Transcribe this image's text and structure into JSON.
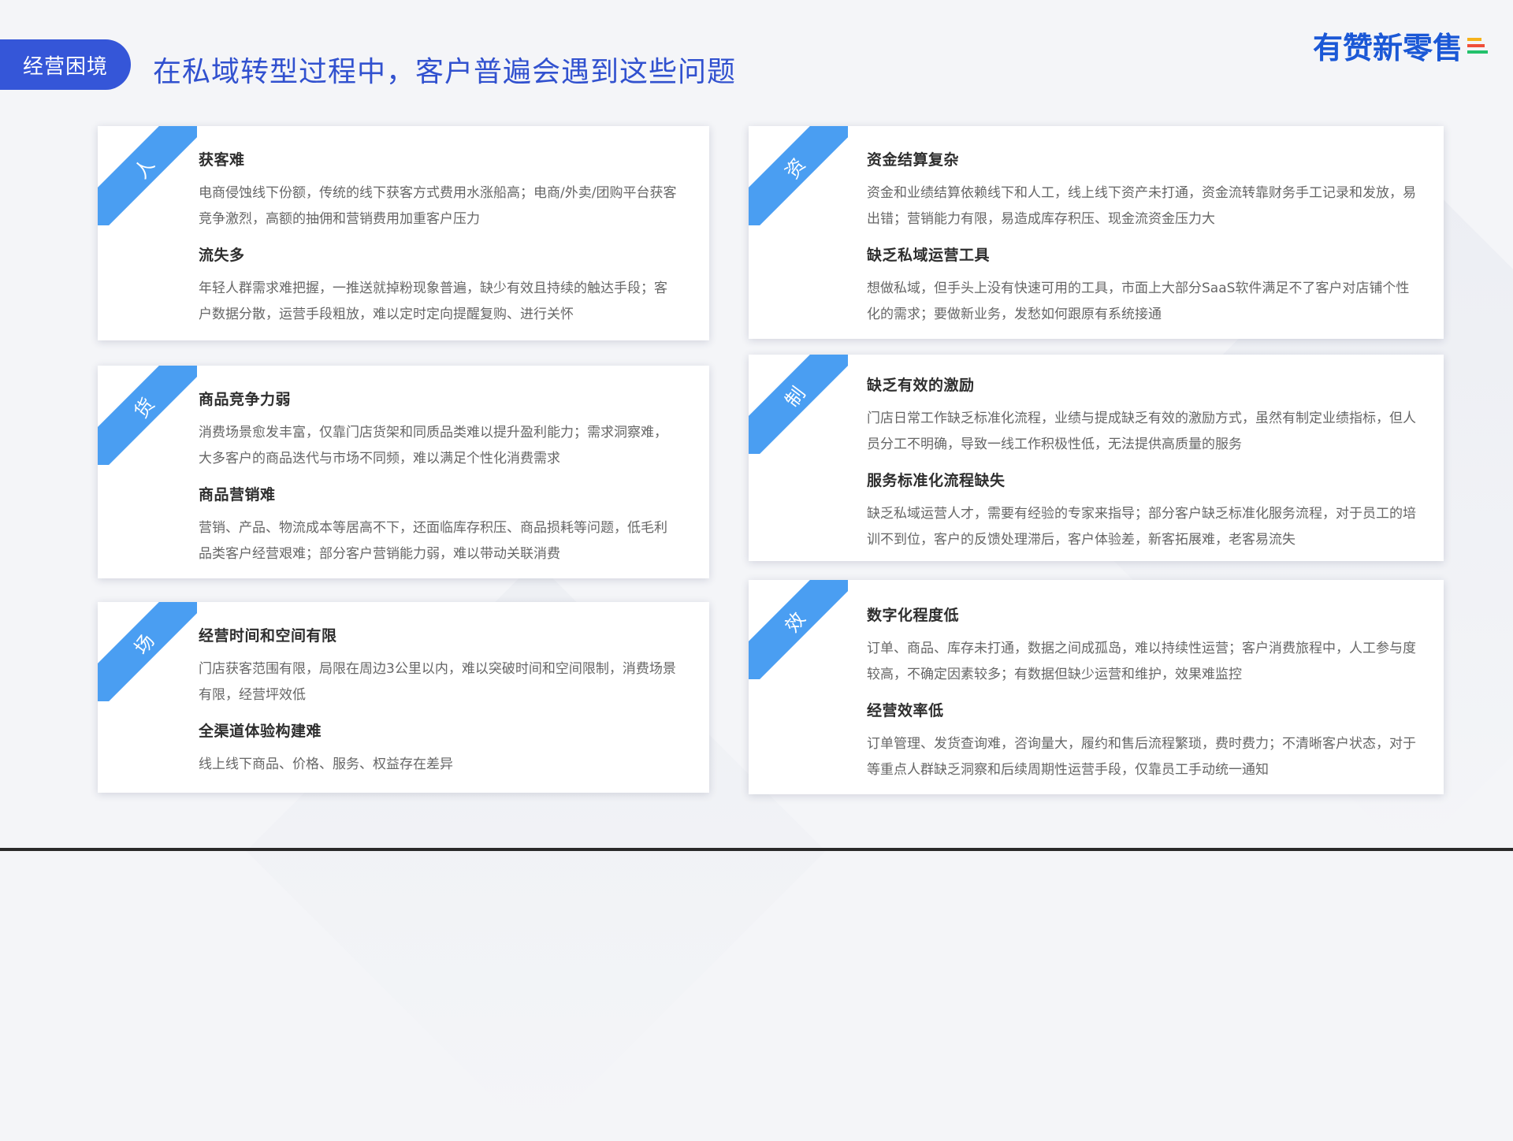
{
  "header": {
    "tag": "经营困境",
    "title": "在私域转型过程中，客户普遍会遇到这些问题",
    "logo": "有赞新零售"
  },
  "cards": [
    {
      "badge": "人",
      "items": [
        {
          "title": "获客难",
          "desc": "电商侵蚀线下份额，传统的线下获客方式费用水涨船高；电商/外卖/团购平台获客竞争激烈，高额的抽佣和营销费用加重客户压力"
        },
        {
          "title": "流失多",
          "desc": "年轻人群需求难把握，一推送就掉粉现象普遍，缺少有效且持续的触达手段；客户数据分散，运营手段粗放，难以定时定向提醒复购、进行关怀"
        }
      ]
    },
    {
      "badge": "货",
      "items": [
        {
          "title": "商品竞争力弱",
          "desc": "消费场景愈发丰富，仅靠门店货架和同质品类难以提升盈利能力；需求洞察难，大多客户的商品迭代与市场不同频，难以满足个性化消费需求"
        },
        {
          "title": "商品营销难",
          "desc": "营销、产品、物流成本等居高不下，还面临库存积压、商品损耗等问题，低毛利品类客户经营艰难；部分客户营销能力弱，难以带动关联消费"
        }
      ]
    },
    {
      "badge": "场",
      "items": [
        {
          "title": "经营时间和空间有限",
          "desc": "门店获客范围有限，局限在周边3公里以内，难以突破时间和空间限制，消费场景有限，经营坪效低"
        },
        {
          "title": "全渠道体验构建难",
          "desc": "线上线下商品、价格、服务、权益存在差异"
        }
      ]
    },
    {
      "badge": "资",
      "items": [
        {
          "title": "资金结算复杂",
          "desc": "资金和业绩结算依赖线下和人工，线上线下资产未打通，资金流转靠财务手工记录和发放，易出错；营销能力有限，易造成库存积压、现金流资金压力大"
        },
        {
          "title": "缺乏私域运营工具",
          "desc": "想做私域，但手头上没有快速可用的工具，市面上大部分SaaS软件满足不了客户对店铺个性化的需求；要做新业务，发愁如何跟原有系统接通"
        }
      ]
    },
    {
      "badge": "制",
      "items": [
        {
          "title": "缺乏有效的激励",
          "desc": "门店日常工作缺乏标准化流程，业绩与提成缺乏有效的激励方式，虽然有制定业绩指标，但人员分工不明确，导致一线工作积极性低，无法提供高质量的服务"
        },
        {
          "title": "服务标准化流程缺失",
          "desc": "缺乏私域运营人才，需要有经验的专家来指导；部分客户缺乏标准化服务流程，对于员工的培训不到位，客户的反馈处理滞后，客户体验差，新客拓展难，老客易流失"
        }
      ]
    },
    {
      "badge": "效",
      "items": [
        {
          "title": "数字化程度低",
          "desc": "订单、商品、库存未打通，数据之间成孤岛，难以持续性运营；客户消费旅程中，人工参与度较高，不确定因素较多；有数据但缺少运营和维护，效果难监控"
        },
        {
          "title": "经营效率低",
          "desc": "订单管理、发货查询难，咨询量大，履约和售后流程繁琐，费时费力；不清晰客户状态，对于等重点人群缺乏洞察和后续周期性运营手段，仅靠员工手动统一通知"
        }
      ]
    }
  ]
}
